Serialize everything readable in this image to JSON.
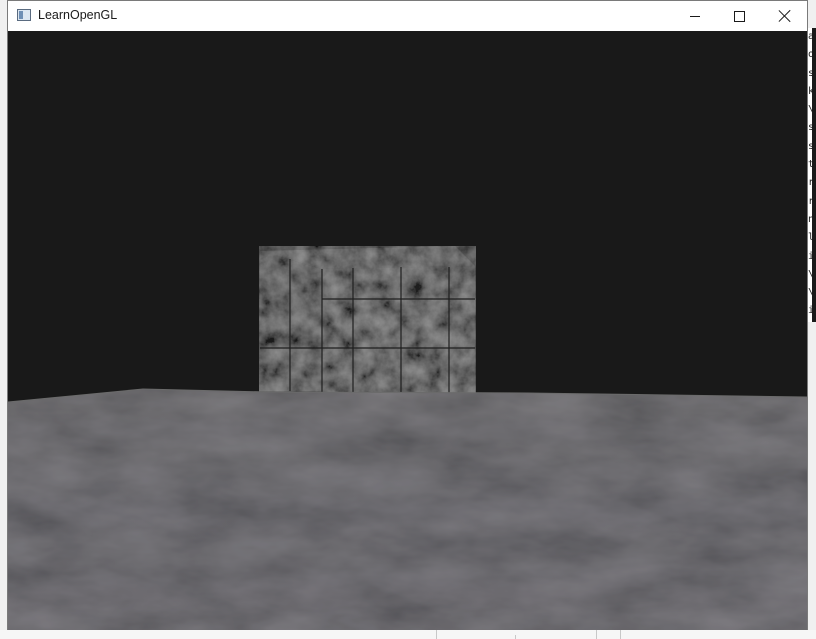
{
  "window": {
    "title": "LearnOpenGL",
    "icon": "app-window-icon",
    "controls": [
      "minimize-icon",
      "maximize-icon",
      "close-icon"
    ]
  },
  "scene": {
    "clear_color": "#191919",
    "objects": [
      "marble-cube",
      "floor-plane"
    ],
    "cube_colors": [
      "#3c3c3c",
      "#2a2a2a",
      "#4a4a4a"
    ],
    "floor_colors": [
      "#5f5f5f",
      "#4e4e4e",
      "#6a6a6a"
    ]
  },
  "background_console": {
    "visible_fragments": [
      "at",
      "o",
      "st",
      "kt",
      "\\D",
      "sk",
      "sk",
      "tr",
      "r\\",
      "rs",
      "ni",
      "lm",
      "ir",
      "\\D",
      "\\D",
      "ir",
      "ni"
    ]
  }
}
